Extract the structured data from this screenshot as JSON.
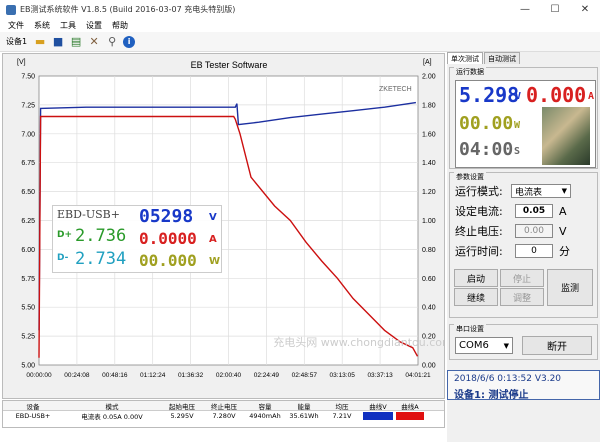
{
  "window": {
    "title": "EB测试系统软件 V1.8.5 (Build 2016-03-07 充电头特别版)",
    "min": "—",
    "max": "☐",
    "close": "✕"
  },
  "menu": [
    "文件",
    "系统",
    "工具",
    "设置",
    "帮助"
  ],
  "toolbar": {
    "device_label": "设备1"
  },
  "chart": {
    "title": "EB Tester Software",
    "left_unit": "[V]",
    "right_unit": "[A]",
    "brand": "ZKETECH"
  },
  "chart_data": {
    "type": "line",
    "title": "EB Tester Software",
    "x_ticks": [
      "00:00:00",
      "00:24:08",
      "00:48:16",
      "01:12:24",
      "01:36:32",
      "02:00:40",
      "02:24:49",
      "02:48:57",
      "03:13:05",
      "03:37:13",
      "04:01:21"
    ],
    "y_left_ticks": [
      "7.50",
      "7.25",
      "7.00",
      "6.75",
      "6.50",
      "6.25",
      "6.00",
      "5.75",
      "5.50",
      "5.25",
      "5.00"
    ],
    "y_right_ticks": [
      "2.00",
      "1.80",
      "1.60",
      "1.40",
      "1.20",
      "1.00",
      "0.80",
      "0.60",
      "0.40",
      "0.20",
      "0.00"
    ],
    "ylim_left": [
      5.0,
      7.5
    ],
    "ylim_right": [
      0.0,
      2.0
    ],
    "xlim_minutes": [
      0,
      241.35
    ],
    "series": [
      {
        "color": "#1c2fa0",
        "axis": "left",
        "points": [
          [
            0,
            5.3
          ],
          [
            1,
            7.22
          ],
          [
            30,
            7.23
          ],
          [
            60,
            7.23
          ],
          [
            90,
            7.23
          ],
          [
            120,
            7.23
          ],
          [
            125,
            7.23
          ],
          [
            126,
            7.26
          ],
          [
            127,
            7.08
          ],
          [
            140,
            7.1
          ],
          [
            160,
            7.14
          ],
          [
            180,
            7.17
          ],
          [
            200,
            7.2
          ],
          [
            220,
            7.23
          ],
          [
            240,
            7.27
          ]
        ]
      },
      {
        "color": "#cc1010",
        "axis": "right",
        "points": [
          [
            0,
            0.05
          ],
          [
            1,
            1.72
          ],
          [
            30,
            1.72
          ],
          [
            60,
            1.72
          ],
          [
            90,
            1.72
          ],
          [
            120,
            1.72
          ],
          [
            124,
            1.72
          ],
          [
            125,
            1.7
          ],
          [
            128,
            1.6
          ],
          [
            135,
            1.3
          ],
          [
            150,
            1.1
          ],
          [
            160,
            1.0
          ],
          [
            170,
            0.85
          ],
          [
            180,
            0.72
          ],
          [
            190,
            0.6
          ],
          [
            200,
            0.46
          ],
          [
            210,
            0.35
          ],
          [
            220,
            0.24
          ],
          [
            230,
            0.16
          ],
          [
            238,
            0.12
          ],
          [
            241,
            0.06
          ]
        ]
      }
    ]
  },
  "overlay": {
    "device": "EBD-USB+",
    "voltage": "05298",
    "voltage_unit": "V",
    "dplus_label": "D+",
    "dplus": "2.736",
    "current": "0.0000",
    "current_unit": "A",
    "dminus_label": "D-",
    "dminus": "2.734",
    "power": "00.000",
    "power_unit": "W"
  },
  "watermark": "充电头网 www.chongdiantou.com",
  "tabs": [
    "单次测试",
    "自动测试"
  ],
  "running": {
    "group_title": "运行数据",
    "voltage": "5.298",
    "voltage_unit": "V",
    "current": "0.000",
    "current_unit": "A",
    "power": "00.00",
    "power_unit": "W",
    "time": "04:00",
    "time_unit": "S"
  },
  "params": {
    "group_title": "参数设置",
    "mode_label": "运行模式:",
    "mode_value": "电流表",
    "current_label": "设定电流:",
    "current_value": "0.05",
    "current_unit": "A",
    "stopv_label": "终止电压:",
    "stopv_value": "0.00",
    "stopv_unit": "V",
    "time_label": "运行时间:",
    "time_value": "0",
    "time_unit": "分",
    "start": "启动",
    "stop": "停止",
    "cont": "继续",
    "adjust": "调整",
    "monitor": "监测"
  },
  "serial": {
    "group_title": "串口设置",
    "port": "COM6",
    "disconnect": "断开"
  },
  "status": {
    "line1": "2018/6/6 0:13:52   V3.20",
    "line2": "设备1: 测试停止"
  },
  "table": {
    "headers": [
      "设备",
      "模式",
      "起始电压",
      "终止电压",
      "容量",
      "能量",
      "均压",
      "曲线V",
      "曲线A"
    ],
    "row": [
      "EBD-USB+",
      "电流表 0.05A 0.00V",
      "5.295V",
      "7.280V",
      "4940mAh",
      "35.61Wh",
      "7.21V",
      "",
      ""
    ],
    "curveV_color": "#1030c0",
    "curveA_color": "#e01010"
  }
}
